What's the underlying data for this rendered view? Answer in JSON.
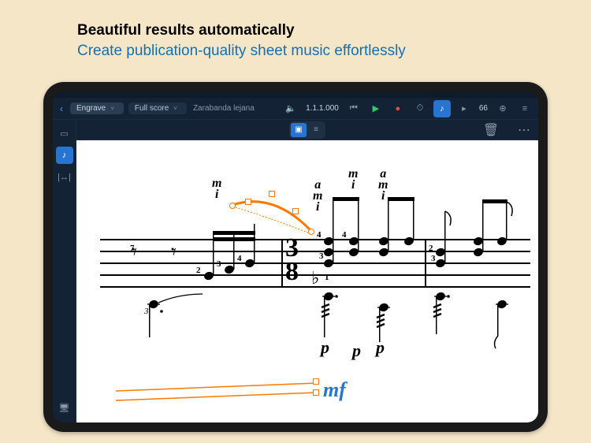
{
  "marketing": {
    "headline": "Beautiful results automatically",
    "subheadline": "Create publication-quality sheet music effortlessly"
  },
  "topbar": {
    "mode": "Engrave",
    "layout": "Full score",
    "project_name": "Zarabanda lejana",
    "position": "1.1.1.000",
    "tempo": "66"
  },
  "toolbar_icons": {
    "back": "‹",
    "speaker": "🔈",
    "skip_back": "⏮",
    "play": "▶",
    "record": "●",
    "click": "⏱",
    "note": "♪",
    "metronome": "▸",
    "zoom": "⊕",
    "hamburger": "≡"
  },
  "sidebar": {
    "panels_icon": "▭",
    "notes_icon": "♪",
    "bars_icon": "|↔|",
    "monitor_icon": "🖥"
  },
  "secondbar": {
    "graphic_icon": "▣",
    "staff_icon": "≡",
    "trash_icon": "🗑",
    "more_icon": "⋯"
  },
  "score": {
    "time_sig_top": "3",
    "time_sig_bottom": "8",
    "fingerings": {
      "m": "m",
      "i": "i",
      "a": "a"
    },
    "fret_numbers": {
      "n1": "1",
      "n2": "2",
      "n3": "3",
      "n4": "4",
      "n7": "7"
    },
    "dynamics": {
      "p": "p",
      "mf": "mf"
    },
    "tuplet": "3"
  }
}
